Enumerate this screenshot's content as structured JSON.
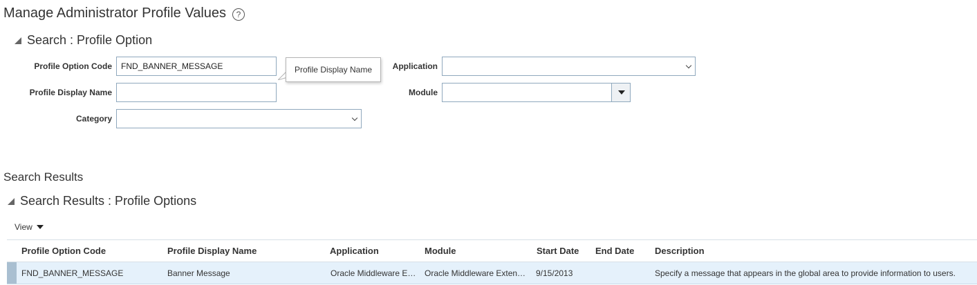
{
  "page": {
    "title": "Manage Administrator Profile Values",
    "help_icon": "?"
  },
  "search": {
    "header": "Search : Profile Option",
    "labels": {
      "profile_option_code": "Profile Option Code",
      "profile_display_name": "Profile Display Name",
      "category": "Category",
      "application": "Application",
      "module": "Module"
    },
    "values": {
      "profile_option_code": "FND_BANNER_MESSAGE",
      "profile_display_name": "",
      "category": "",
      "application": "",
      "module": ""
    },
    "tooltip": "Profile Display Name"
  },
  "results": {
    "title": "Search Results",
    "header": "Search Results : Profile Options",
    "view_menu": "View",
    "columns": {
      "code": "Profile Option Code",
      "display_name": "Profile Display Name",
      "application": "Application",
      "module": "Module",
      "start_date": "Start Date",
      "end_date": "End Date",
      "description": "Description"
    },
    "rows": [
      {
        "code": "FND_BANNER_MESSAGE",
        "display_name": "Banner Message",
        "application": "Oracle Middleware E…",
        "module": "Oracle Middleware Exten…",
        "start_date": "9/15/2013",
        "end_date": "",
        "description": "Specify a message that appears in the global area to provide information to users."
      }
    ]
  },
  "colors": {
    "accent_border": "#8fa8bd",
    "selected_row": "#e5f1fb",
    "row_marker": "#a9bfd1"
  },
  "icons": [
    "help-icon",
    "collapse-triangle-icon",
    "chevron-down-icon",
    "dropdown-caret-icon"
  ]
}
